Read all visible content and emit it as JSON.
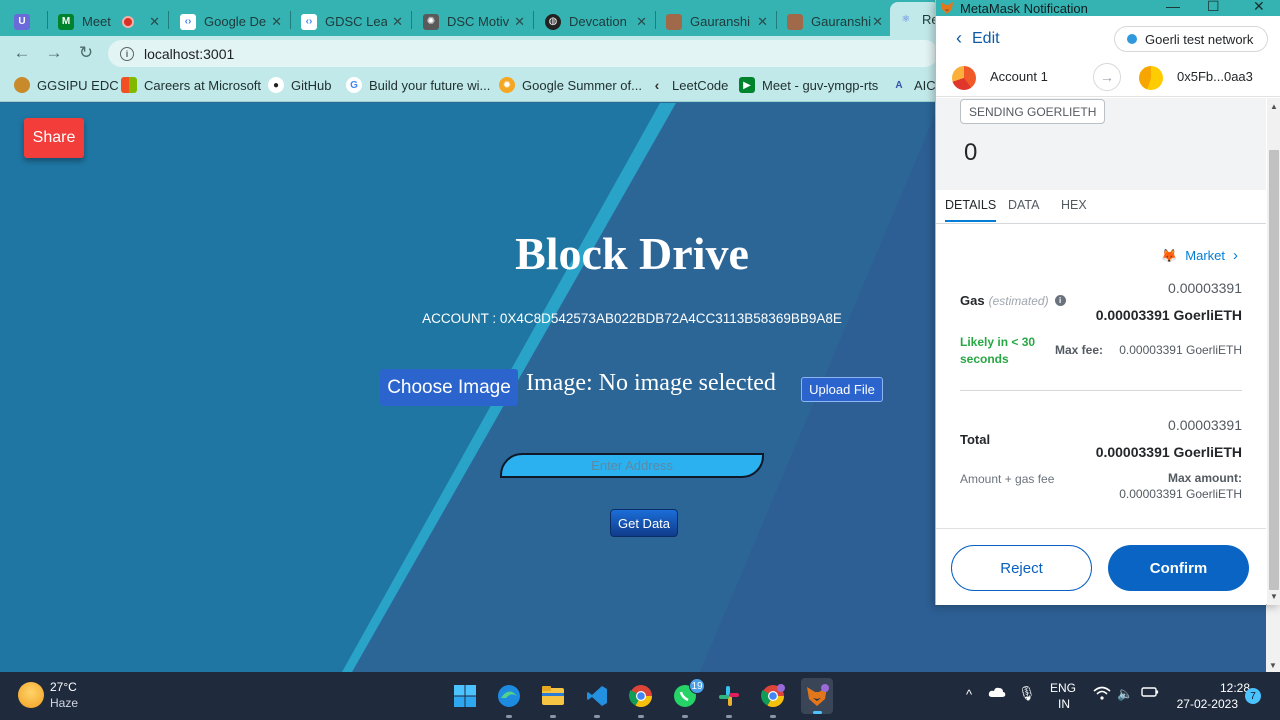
{
  "browser": {
    "tabs": [
      {
        "label": ""
      },
      {
        "label": "Meet"
      },
      {
        "label": "Google De"
      },
      {
        "label": "GDSC Lea"
      },
      {
        "label": "DSC Motiv"
      },
      {
        "label": "Devcation"
      },
      {
        "label": "Gauranshi"
      },
      {
        "label": "Gauranshi"
      },
      {
        "label": "Re"
      }
    ],
    "url": "localhost:3001",
    "bookmarks": [
      {
        "label": "GGSIPU EDC"
      },
      {
        "label": "Careers at Microsoft"
      },
      {
        "label": "GitHub"
      },
      {
        "label": "Build your future wi..."
      },
      {
        "label": "Google Summer of..."
      },
      {
        "label": "LeetCode"
      },
      {
        "label": "Meet - guv-ymgp-rts"
      },
      {
        "label": "AIC"
      }
    ]
  },
  "app": {
    "share_label": "Share",
    "title": "Block Drive",
    "account": "ACCOUNT : 0X4C8D542573AB022BDB72A4CC3113B58369BB9A8E",
    "choose_label": "Choose Image",
    "image_status": "Image: No image selected",
    "upload_label": "Upload File",
    "address_placeholder": "Enter Address",
    "getdata_label": "Get Data"
  },
  "metamask": {
    "window_title": "MetaMask Notification",
    "edit_label": "Edit",
    "network": "Goerli test network",
    "from_account": "Account 1",
    "to_account": "0x5Fb...0aa3",
    "sending_label": "SENDING GOERLIETH",
    "amount": "0",
    "tabs": [
      "DETAILS",
      "DATA",
      "HEX"
    ],
    "market_label": "Market",
    "gas_label": "Gas",
    "gas_estimated": "(estimated)",
    "gas_value": "0.00003391",
    "gas_value_bold": "0.00003391 GoerliETH",
    "likely": "Likely in < 30 seconds",
    "max_fee_label": "Max fee:",
    "max_fee_value": "0.00003391 GoerliETH",
    "total_label": "Total",
    "total_value": "0.00003391",
    "total_value_bold": "0.00003391 GoerliETH",
    "amount_gas_label": "Amount + gas fee",
    "max_amount_label": "Max amount:",
    "max_amount_value": "0.00003391 GoerliETH",
    "reject_label": "Reject",
    "confirm_label": "Confirm",
    "colors": {
      "accent": "#037dd6",
      "success": "#28a745"
    }
  },
  "taskbar": {
    "temperature": "27°C",
    "weather": "Haze",
    "whatsapp_badge": "19",
    "language": "ENG",
    "region": "IN",
    "time": "12:28",
    "date": "27-02-2023",
    "notifications": "7"
  }
}
